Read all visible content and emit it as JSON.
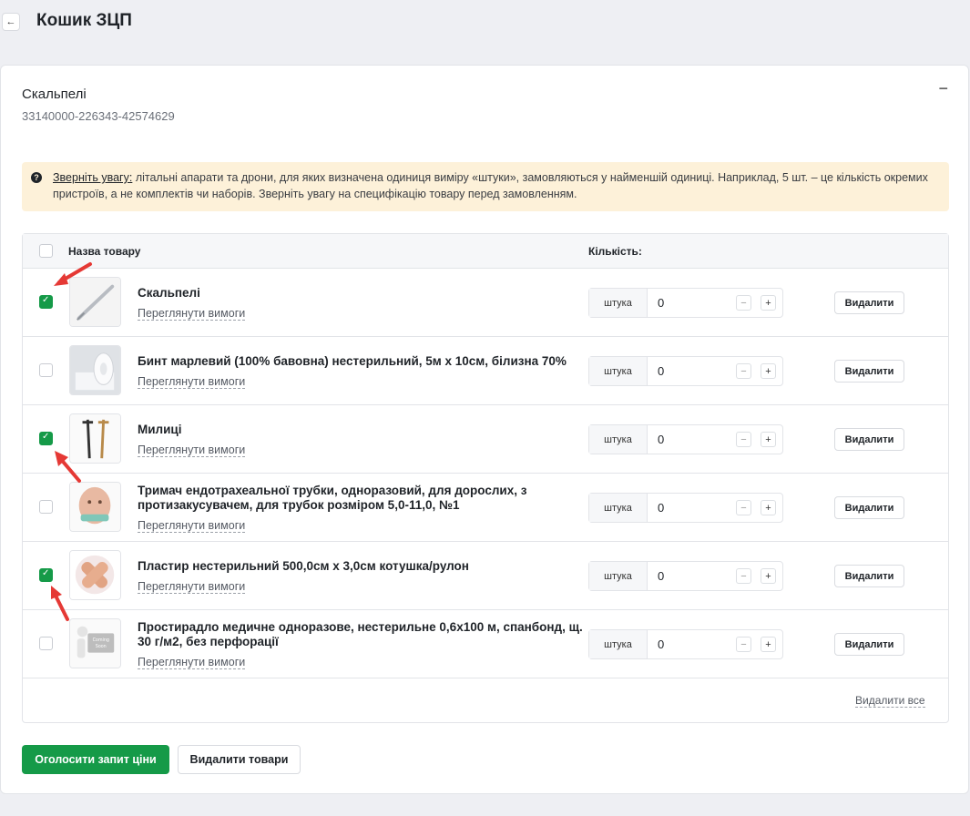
{
  "header": {
    "back_icon": "arrow-left-icon",
    "back_glyph": "←",
    "title": "Кошик ЗЦП"
  },
  "lot": {
    "title": "Скальпелі",
    "code": "33140000-226343-42574629",
    "collapse_glyph": "−"
  },
  "notice": {
    "icon_glyph": "?",
    "lead": "Зверніть увагу:",
    "text": " літальні апарати та дрони, для яких визначена одиниця виміру «штуки», замовляються у найменшій одиниці. Наприклад, 5 шт. – це кількість окремих пристроїв, а не комплектів чи наборів. Зверніть увагу на специфікацію товару перед замовленням."
  },
  "table": {
    "col_name": "Назва товару",
    "col_qty": "Кількість:",
    "select_all_checked": false,
    "items": [
      {
        "name": "Скальпелі",
        "requirements": "Переглянути вимоги",
        "unit": "штука",
        "qty": "0",
        "minus": "−",
        "plus": "+",
        "delete": "Видалити",
        "checked": true,
        "image": "scalpel"
      },
      {
        "name": "Бинт марлевий (100% бавовна) нестерильний, 5м х 10см, білизна 70%",
        "requirements": "Переглянути вимоги",
        "unit": "штука",
        "qty": "0",
        "minus": "−",
        "plus": "+",
        "delete": "Видалити",
        "checked": false,
        "image": "bandage"
      },
      {
        "name": "Милиці",
        "requirements": "Переглянути вимоги",
        "unit": "штука",
        "qty": "0",
        "minus": "−",
        "plus": "+",
        "delete": "Видалити",
        "checked": true,
        "image": "crutches"
      },
      {
        "name": "Тримач ендотрахеальної трубки, одноразовий, для дорослих, з протизакусувачем, для трубок розміром 5,0-11,0, №1",
        "requirements": "Переглянути вимоги",
        "unit": "штука",
        "qty": "0",
        "minus": "−",
        "plus": "+",
        "delete": "Видалити",
        "checked": false,
        "image": "tube-holder"
      },
      {
        "name": "Пластир нестерильний 500,0см х 3,0см котушка/рулон",
        "requirements": "Переглянути вимоги",
        "unit": "штука",
        "qty": "0",
        "minus": "−",
        "plus": "+",
        "delete": "Видалити",
        "checked": true,
        "image": "plaster"
      },
      {
        "name": "Простирадло медичне одноразове, нестерильне 0,6х100 м, спанбонд, щ. 30 г/м2, без перфорації",
        "requirements": "Переглянути вимоги",
        "unit": "штука",
        "qty": "0",
        "minus": "−",
        "plus": "+",
        "delete": "Видалити",
        "checked": false,
        "image": "coming-soon",
        "image_text": [
          "Coming",
          "Soon"
        ]
      }
    ],
    "delete_all": "Видалити все"
  },
  "actions": {
    "submit": "Оголосити запит ціни",
    "remove": "Видалити товари"
  },
  "colors": {
    "accent": "#159a48",
    "notice_bg": "#fdf1d9",
    "annotation_arrow": "#e53935"
  }
}
